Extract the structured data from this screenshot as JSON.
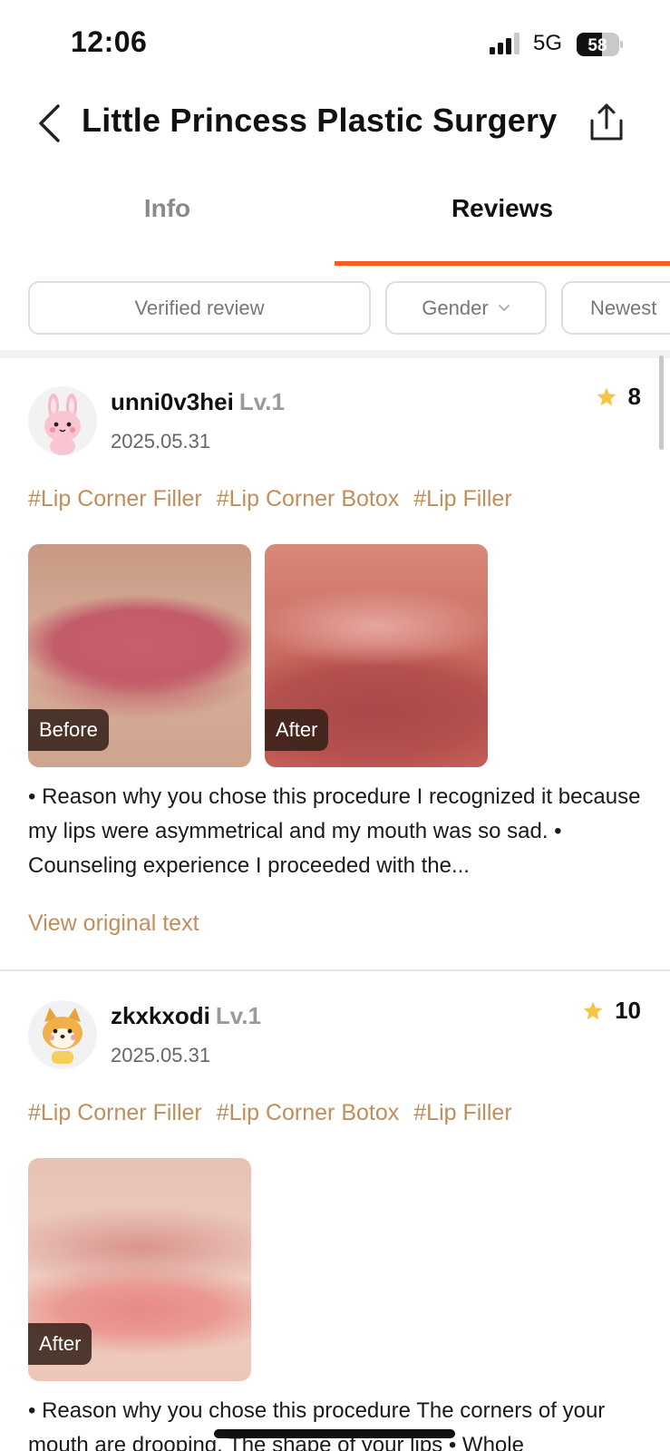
{
  "status_bar": {
    "time": "12:06",
    "network": "5G",
    "battery": "58"
  },
  "header": {
    "title": "Little Princess Plastic Surgery"
  },
  "tabs": [
    {
      "label": "Info",
      "active": false
    },
    {
      "label": "Reviews",
      "active": true
    }
  ],
  "filters": {
    "verified": "Verified review",
    "gender": "Gender",
    "sort": "Newest"
  },
  "colors": {
    "accent": "#ff5a1f",
    "tag": "#c08e5a",
    "star": "#f7c544"
  },
  "reviews": [
    {
      "username": "unni0v3hei",
      "level": "Lv.1",
      "date": "2025.05.31",
      "rating": "8",
      "avatar_icon": "bunny-avatar-icon",
      "tags": [
        "#Lip Corner Filler",
        "#Lip Corner Botox",
        "#Lip Filler"
      ],
      "photos": [
        {
          "label": "Before"
        },
        {
          "label": "After"
        }
      ],
      "text": "• Reason why you chose this procedure I recognized it because my lips were asymmetrical and my mouth was so sad. • Counseling experience I proceeded with the...",
      "view_original": "View original text"
    },
    {
      "username": "zkxkxodi",
      "level": "Lv.1",
      "date": "2025.05.31",
      "rating": "10",
      "avatar_icon": "shiba-avatar-icon",
      "tags": [
        "#Lip Corner Filler",
        "#Lip Corner Botox",
        "#Lip Filler"
      ],
      "photos": [
        {
          "label": "After"
        }
      ],
      "text": "• Reason why you chose this procedure The corners of your mouth are drooping. The shape of your lips • Whole"
    }
  ]
}
